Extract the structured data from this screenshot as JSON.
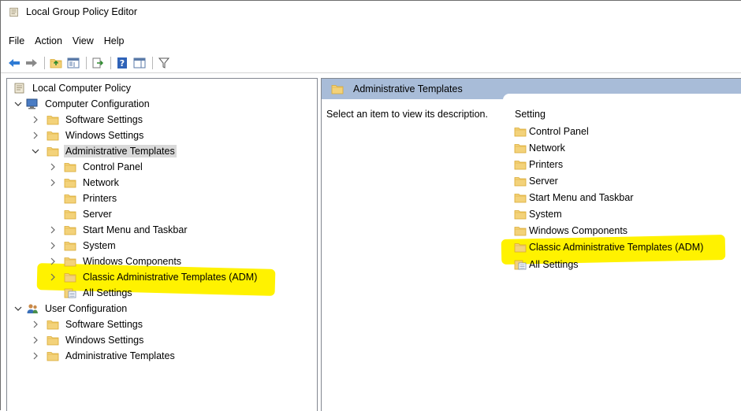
{
  "window": {
    "title": "Local Group Policy Editor"
  },
  "menu": [
    "File",
    "Action",
    "View",
    "Help"
  ],
  "toolbar": {
    "buttons": [
      "back-arrow-icon",
      "forward-arrow-icon",
      "up-folder-icon",
      "show-hide-tree-icon",
      "export-list-icon",
      "help-icon",
      "properties-pane-icon",
      "filter-icon"
    ]
  },
  "tree": {
    "root": "Local Computer Policy",
    "computer_config": "Computer Configuration",
    "cc_software": "Software Settings",
    "cc_windows": "Windows Settings",
    "cc_admin": "Administrative Templates",
    "admin_children": [
      "Control Panel",
      "Network",
      "Printers",
      "Server",
      "Start Menu and Taskbar",
      "System",
      "Windows Components",
      "Classic Administrative Templates (ADM)",
      "All Settings"
    ],
    "user_config": "User Configuration",
    "uc_software": "Software Settings",
    "uc_windows": "Windows Settings",
    "uc_admin": "Administrative Templates"
  },
  "details": {
    "header": "Administrative Templates",
    "description": "Select an item to view its description.",
    "column": "Setting",
    "items": [
      "Control Panel",
      "Network",
      "Printers",
      "Server",
      "Start Menu and Taskbar",
      "System",
      "Windows Components",
      "Classic Administrative Templates (ADM)",
      "All Settings"
    ]
  },
  "colors": {
    "highlight": "#fff200",
    "header_bar": "#a8bcd8",
    "selection": "#d9d9d9",
    "folder": "#f3d27a"
  }
}
